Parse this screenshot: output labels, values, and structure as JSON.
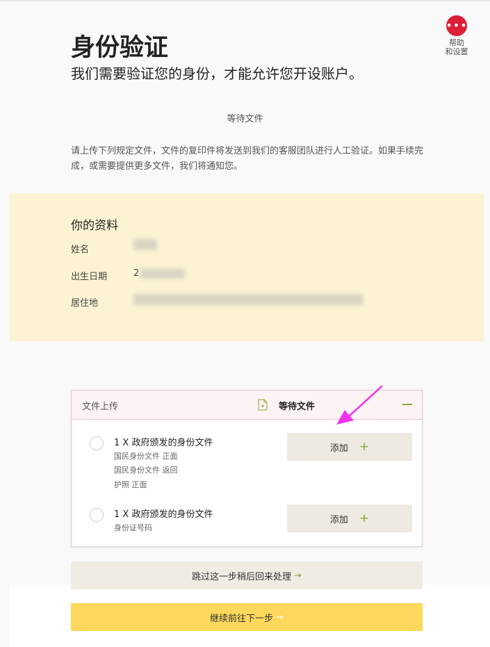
{
  "help": {
    "icon_glyph": "•••",
    "label_line1": "帮助",
    "label_line2": "和设置"
  },
  "header": {
    "title": "身份验证",
    "subtitle": "我们需要验证您的身份，才能允许您开设账户。"
  },
  "status_text": "等待文件",
  "instructions": "请上传下列规定文件，文件的复印件将发送到我们的客服团队进行人工验证。如果手续完成，或需要提供更多文件，我们将通知您。",
  "profile": {
    "title": "你的资料",
    "rows": [
      {
        "label": "姓名",
        "value": ""
      },
      {
        "label": "出生日期",
        "value": "2"
      },
      {
        "label": "居住地",
        "value": ""
      }
    ]
  },
  "upload": {
    "title": "文件上传",
    "status": "等待文件",
    "items": [
      {
        "title": "1 X 政府颁发的身份文件",
        "subs": [
          "国民身份文件  正面",
          "国民身份文件  返回",
          "护照  正面"
        ],
        "add_label": "添加",
        "add_icon": "+"
      },
      {
        "title": "1 X 政府颁发的身份文件",
        "subs": [
          "身份证号码"
        ],
        "add_label": "添加",
        "add_icon": "+"
      }
    ]
  },
  "skip_label": "跳过这一步稍后回来处理",
  "continue_label": "继续前往下一步",
  "arrow_glyph": "→",
  "colors": {
    "help_red": "#dc2038",
    "profile_bg": "#fbf3d2",
    "accent_green": "#8aa832",
    "continue_yellow": "#fdd85c",
    "annotation_magenta": "#ee33ee"
  }
}
